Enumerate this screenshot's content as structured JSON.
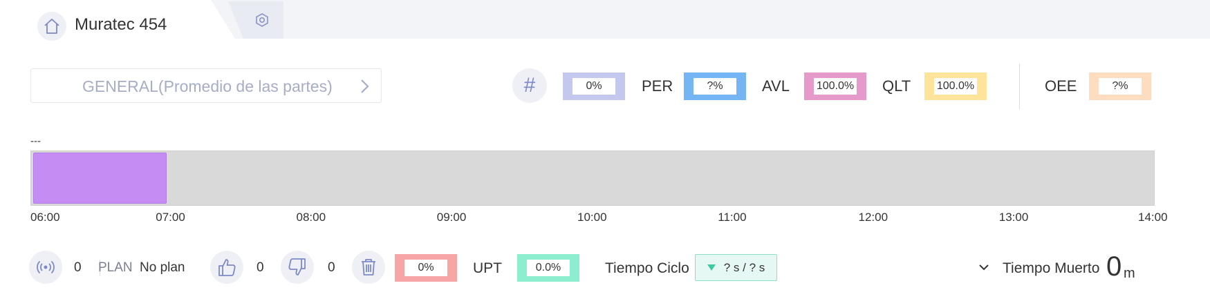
{
  "tab": {
    "title": "Muratec 454",
    "home_icon": "home-icon",
    "settings_icon": "hexagon-settings-icon"
  },
  "selector": {
    "label": "GENERAL(Promedio de las partes)",
    "icon": "chevron-right-icon"
  },
  "metrics": {
    "hash_icon": "#",
    "count": {
      "value": "0%",
      "color": "#c5c8ee"
    },
    "per": {
      "label": "PER",
      "value": "?%",
      "color": "#75b5f4"
    },
    "avl": {
      "label": "AVL",
      "value": "100.0%",
      "color": "#e59acb"
    },
    "qlt": {
      "label": "QLT",
      "value": "100.0%",
      "color": "#fde49a"
    },
    "oee": {
      "label": "OEE",
      "value": "?%",
      "color": "#fedcbf"
    }
  },
  "timeline": {
    "label": "---",
    "start": "06:00",
    "end": "14:00",
    "ticks": [
      "06:00",
      "07:00",
      "08:00",
      "09:00",
      "10:00",
      "11:00",
      "12:00",
      "13:00",
      "14:00"
    ],
    "segments": [
      {
        "from": "06:00",
        "to": "06:58",
        "color": "#c58cf4"
      }
    ],
    "background": "#d9d9d9"
  },
  "bottom": {
    "signal_icon": "signal-broadcast-icon",
    "signal_count": "0",
    "plan_label": "PLAN",
    "plan_value": "No plan",
    "thumbs_up_icon": "thumbs-up-icon",
    "good_count": "0",
    "thumbs_down_icon": "thumbs-down-icon",
    "bad_count": "0",
    "trash_icon": "trash-icon",
    "scrap_pct": {
      "value": "0%",
      "color": "#f7a5a5"
    },
    "upt_label": "UPT",
    "upt_pct": {
      "value": "0.0%",
      "color": "#8ceecf"
    },
    "cycle_label": "Tiempo Ciclo",
    "cycle_value": "? s / ? s",
    "dead_icon": "chevron-down-icon",
    "dead_label": "Tiempo Muerto",
    "dead_value": "0",
    "dead_unit": "m"
  }
}
